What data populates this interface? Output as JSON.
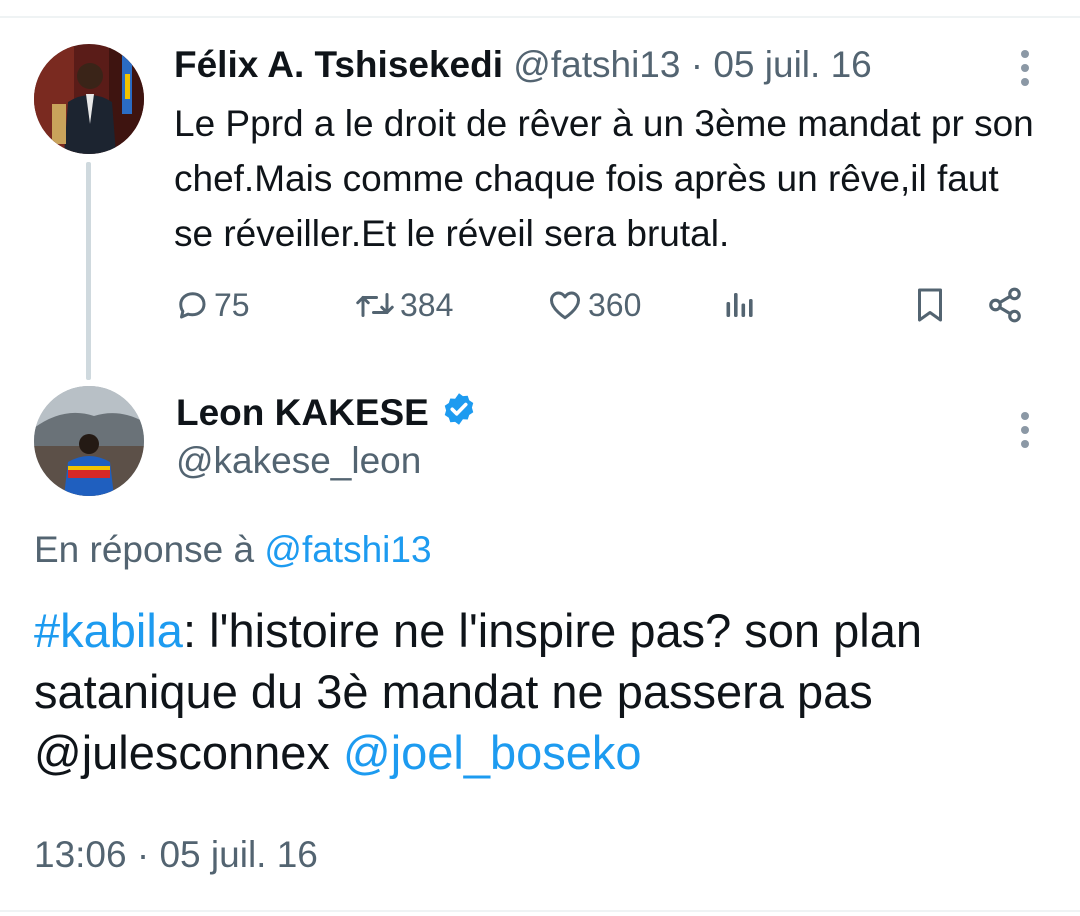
{
  "original_tweet": {
    "author_name": "Félix A. Tshisekedi",
    "author_handle": "@fatshi13",
    "separator": "·",
    "date": "05 juil. 16",
    "text": "Le Pprd a le droit de rêver à un 3ème mandat pr son chef.Mais comme chaque fois après un rêve,il faut se réveiller.Et le réveil sera brutal.",
    "metrics": {
      "replies": "75",
      "reposts": "384",
      "likes": "360"
    }
  },
  "reply_tweet": {
    "author_name": "Leon KAKESE",
    "author_handle": "@kakese_leon",
    "verified": true,
    "reply_prefix": "En réponse à",
    "reply_to_handle": "@fatshi13",
    "text_hashtag": "#kabila",
    "text_body": ": l'histoire ne l'inspire pas? son plan satanique du 3è mandat ne passera pas @julesconnex ",
    "text_mention": "@joel_boseko",
    "time": "13:06",
    "separator": "·",
    "date": "05 juil. 16"
  },
  "icons": {
    "reply": "speech-bubble-icon",
    "repost": "repost-arrows-icon",
    "like": "heart-icon",
    "views": "analytics-bars-icon",
    "bookmark": "bookmark-icon",
    "share": "share-nodes-icon",
    "more": "vertical-dots-icon",
    "verified": "verified-badge-icon"
  },
  "colors": {
    "link": "#1d9bf0",
    "secondary_text": "#536471",
    "primary_text": "#0f1419",
    "verified_badge": "#1d9bf0",
    "thread_line": "#cfd9de"
  }
}
